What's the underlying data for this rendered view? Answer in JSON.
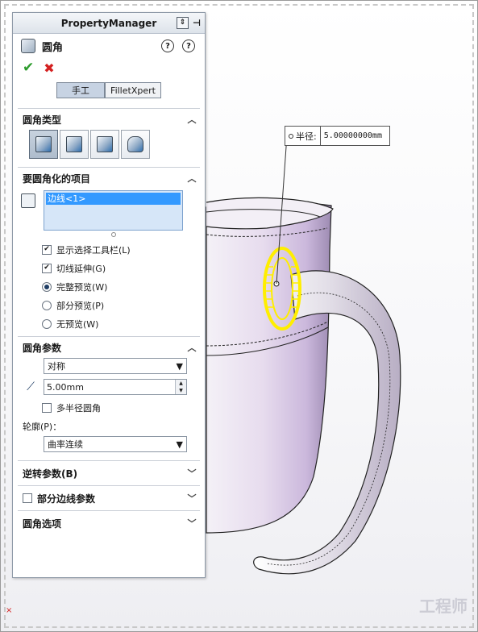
{
  "panel": {
    "title": "PropertyManager",
    "feature_name": "圆角",
    "help_label": "?",
    "tabs": [
      "手工",
      "FilletXpert"
    ]
  },
  "fillet_type": {
    "header": "圆角类型",
    "options": [
      "constant-size-icon",
      "variable-size-icon",
      "face-fillet-icon",
      "full-round-icon"
    ],
    "selected": 0
  },
  "items": {
    "header": "要圆角化的项目",
    "list": [
      "边线<1>"
    ],
    "checkboxes": [
      {
        "label": "显示选择工具栏(L)",
        "checked": true
      },
      {
        "label": "切线延伸(G)",
        "checked": true
      }
    ],
    "radios": [
      {
        "label": "完整预览(W)",
        "selected": true
      },
      {
        "label": "部分预览(P)",
        "selected": false
      },
      {
        "label": "无预览(W)",
        "selected": false
      }
    ]
  },
  "params": {
    "header": "圆角参数",
    "method": "对称",
    "radius": "5.00mm",
    "multi_radius_label": "多半径圆角",
    "multi_radius_checked": false,
    "profile_label": "轮廓(P)：",
    "profile": "曲率连续"
  },
  "collapsed_sections": {
    "setback": "逆转参数(B)",
    "partial_edge": "部分边线参数",
    "options": "圆角选项"
  },
  "callout": {
    "label": "半径:",
    "value": "5.00000000mm"
  },
  "watermark": "工程师",
  "colors": {
    "selection_yellow": "#ffee00",
    "mug_body": "#e4d9ee",
    "list_highlight": "#3399ff",
    "ok_green": "#2c9b2c",
    "cancel_red": "#d42020"
  }
}
